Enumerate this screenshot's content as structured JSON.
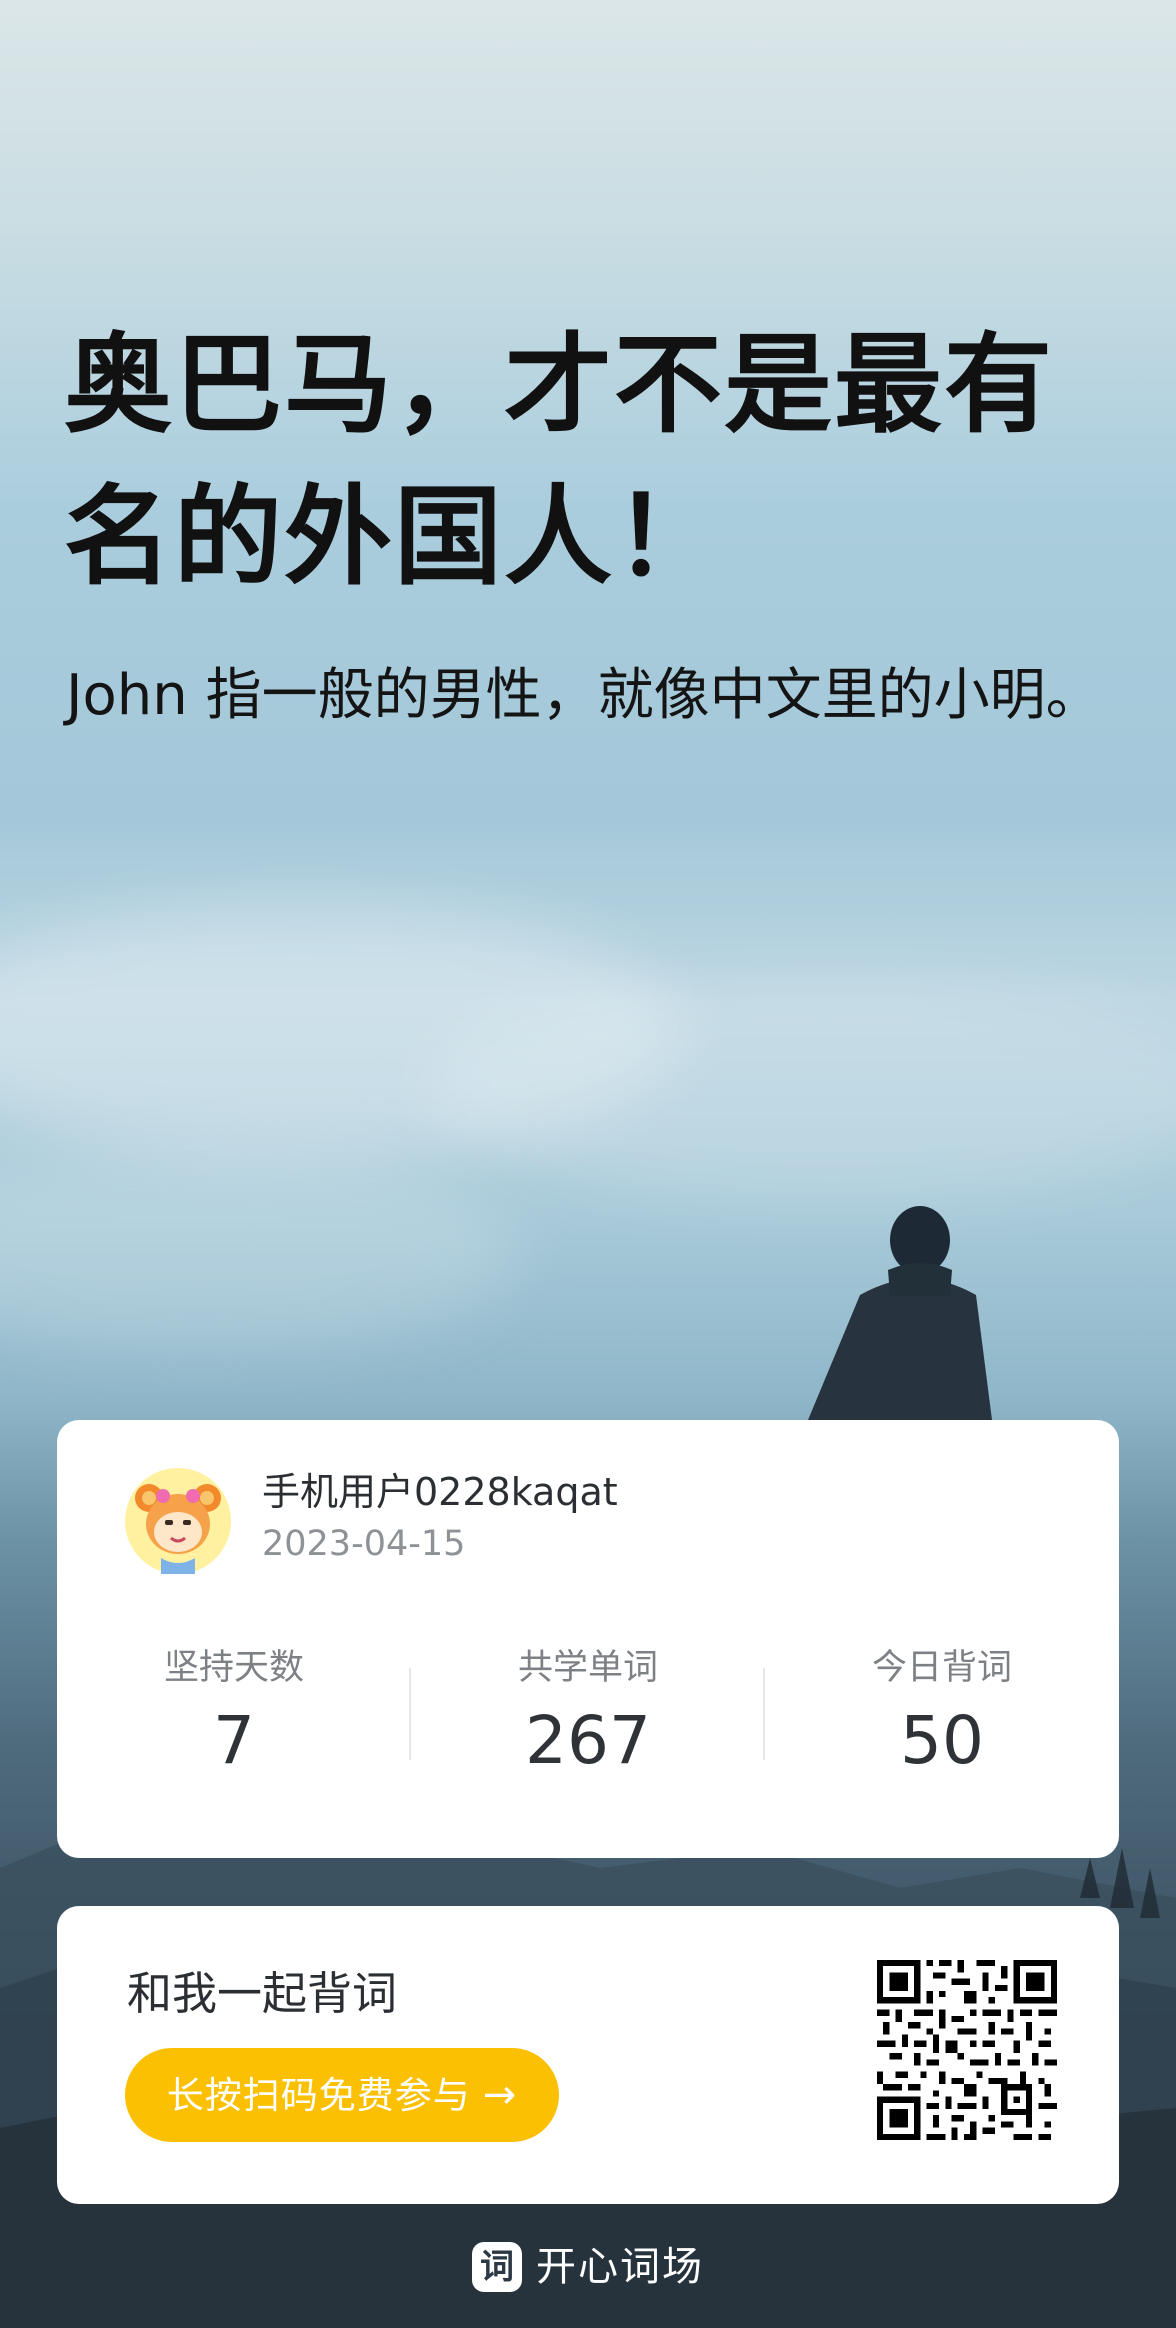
{
  "headline": "奥巴马，才不是最有名的外国人！",
  "subline": "John 指一般的男性，就像中文里的小明。",
  "profile": {
    "username": "手机用户0228kaqat",
    "date": "2023-04-15",
    "stats": [
      {
        "label": "坚持天数",
        "value": "7"
      },
      {
        "label": "共学单词",
        "value": "267"
      },
      {
        "label": "今日背词",
        "value": "50"
      }
    ]
  },
  "invite": {
    "title": "和我一起背词",
    "button_label": "长按扫码免费参与",
    "button_icon": "arrow-right-icon",
    "button_color": "#fcc003"
  },
  "brand": {
    "logo_char": "词",
    "name": "开心词场"
  }
}
